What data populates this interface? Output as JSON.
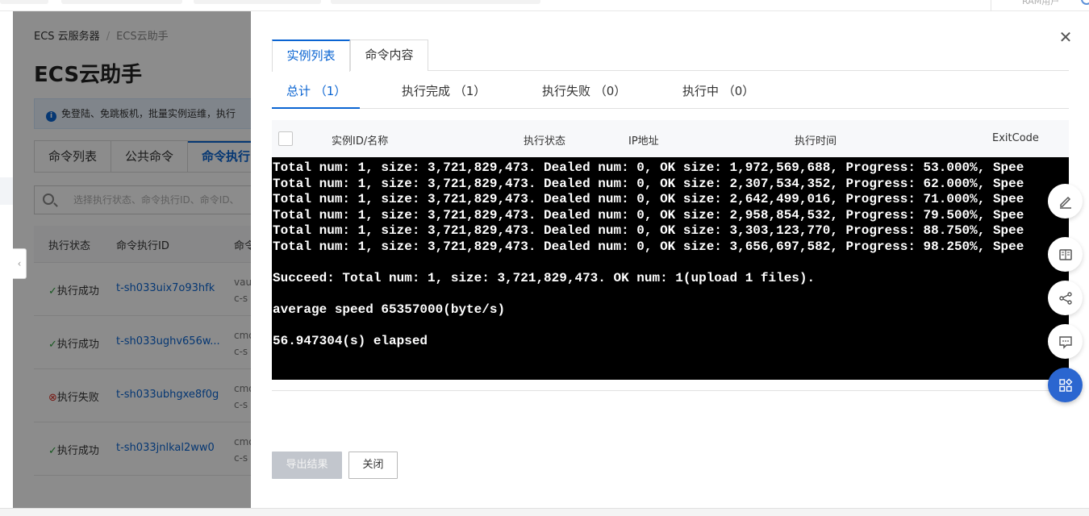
{
  "top_bar": {
    "account_label": "RAM用户"
  },
  "background_page": {
    "breadcrumb": [
      "ECS 云服务器",
      "ECS云助手"
    ],
    "title": "ECS云助手",
    "info_text": "免登陆、免跳板机，批量实例运维，执行",
    "tabs": [
      "命令列表",
      "公共命令",
      "命令执行"
    ],
    "search_placeholder": "选择执行状态、命令执行ID、命令ID、",
    "table_headers": [
      "执行状态",
      "命令执行ID",
      "命令"
    ],
    "rows": [
      {
        "status": "执行成功",
        "status_type": "success",
        "exec_id": "t-sh033uix7o93hfk",
        "cmd_line1": "vau",
        "cmd_line2": "c-s"
      },
      {
        "status": "执行成功",
        "status_type": "success",
        "exec_id": "t-sh033ughv656w...",
        "cmd_line1": "cmo",
        "cmd_line2": "c-s"
      },
      {
        "status": "执行失败",
        "status_type": "failed",
        "exec_id": "t-sh033ubhgxe8f0g",
        "cmd_line1": "cmo",
        "cmd_line2": "c-s"
      },
      {
        "status": "执行成功",
        "status_type": "success",
        "exec_id": "t-sh033jnlkal2ww0",
        "cmd_line1": "cmo",
        "cmd_line2": "c-s"
      }
    ]
  },
  "drawer": {
    "top_tabs": [
      "实例列表",
      "命令内容"
    ],
    "sub_tabs": [
      "总计 （1）",
      "执行完成 （1）",
      "执行失败 （0）",
      "执行中 （0）"
    ],
    "table_headers": [
      "实例ID/名称",
      "执行状态",
      "IP地址",
      "执行时间",
      "ExitCode"
    ],
    "output_lines": [
      "Total num: 1, size: 3,721,829,473. Dealed num: 0, OK size: 1,972,569,688, Progress: 53.000%, Spee",
      "Total num: 1, size: 3,721,829,473. Dealed num: 0, OK size: 2,307,534,352, Progress: 62.000%, Spee",
      "Total num: 1, size: 3,721,829,473. Dealed num: 0, OK size: 2,642,499,016, Progress: 71.000%, Spee",
      "Total num: 1, size: 3,721,829,473. Dealed num: 0, OK size: 2,958,854,532, Progress: 79.500%, Spee",
      "Total num: 1, size: 3,721,829,473. Dealed num: 0, OK size: 3,303,123,770, Progress: 88.750%, Spee",
      "Total num: 1, size: 3,721,829,473. Dealed num: 0, OK size: 3,656,697,582, Progress: 98.250%, Spee",
      "",
      "Succeed: Total num: 1, size: 3,721,829,473. OK num: 1(upload 1 files).",
      "",
      "average speed 65357000(byte/s)",
      "",
      "56.947304(s) elapsed"
    ],
    "buttons": {
      "export": "导出结果",
      "close": "关闭"
    }
  },
  "side_tools": [
    "edit-icon",
    "book-icon",
    "share-icon",
    "feedback-icon",
    "apps-icon"
  ],
  "colors": {
    "accent": "#0a64d2",
    "success": "#2c9e3c",
    "failed": "#d93026",
    "terminal_bg": "#000000",
    "fab_blue": "#2b66d0"
  }
}
